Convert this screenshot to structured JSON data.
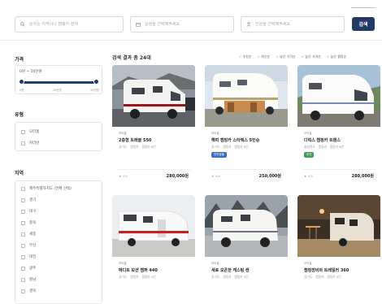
{
  "search": {
    "location_placeholder": "원하는 지역이나 캠핑카 검색",
    "date_placeholder": "일정을 선택해주세요",
    "guests_placeholder": "인원을 선택해주세요",
    "button_label": "검색"
  },
  "sidebar": {
    "price_title": "가격",
    "price_range_label": "0원 ~ 50만원",
    "price_ticks": [
      "0원",
      "25만원",
      "50만원"
    ],
    "price_range_fraction": [
      0.0,
      1.0
    ],
    "type_title": "유형",
    "types": [
      "모터홈",
      "카라반"
    ],
    "region_title": "지역",
    "regions": [
      "제주특별자치도 (전체 선택)",
      "경기",
      "대구",
      "충북",
      "세종",
      "부산",
      "대전",
      "광주",
      "충남",
      "경북"
    ]
  },
  "results": {
    "title": "검색 결과 총 24대",
    "sort_options": [
      "추천순",
      "최신순",
      "낮은 가격순",
      "높은 가격순",
      "높은 평점순"
    ],
    "cards": [
      {
        "type": "모터홈",
        "name": "2층형 트래블 550",
        "location": "경기도 · 캠핑카 · 캠핑카 6인",
        "badge": "",
        "rating": "★ 4.9",
        "price": "280,000원"
      },
      {
        "type": "모터홈",
        "name": "해피 캠핑카 스타렉스 5인승",
        "location": "경기도 · 캠핑카 · 캠핑카 6인",
        "badge": "반려동물",
        "rating": "★ 4.8",
        "price": "250,000원"
      },
      {
        "type": "모터홈",
        "name": "디럭스 캠핑카 트랜스",
        "location": "충청북도 · 캠핑카 · 캠핑카 6인",
        "badge": "추천",
        "rating": "★ 4.9",
        "price": "280,000원"
      },
      {
        "type": "모터홈",
        "name": "에디트 모션 캠퍼 440",
        "location": "경기도 · 캠핑카 · 캠핑카 4인",
        "badge": "",
        "rating": "",
        "price": ""
      },
      {
        "type": "모터홈",
        "name": "새로 오픈한 캐스팅 캔",
        "location": "경기도 · 캠핑카 · 캠핑카 4인",
        "badge": "",
        "rating": "",
        "price": ""
      },
      {
        "type": "모터홈",
        "name": "캠핑장비의 트레일러 360",
        "location": "경기도 · 캠핑카 · 캠핑카 4인",
        "badge": "",
        "rating": "",
        "price": ""
      }
    ]
  },
  "colors": {
    "accent": "#243a66",
    "badge_blue": "#3a6fc4",
    "badge_green": "#3f9e57"
  }
}
